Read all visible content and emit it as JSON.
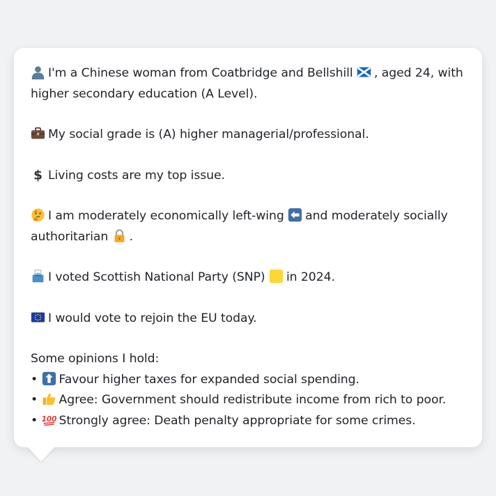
{
  "profile": {
    "identity": {
      "icon": "person-silhouette-icon",
      "text_before_flag": "I'm a Chinese woman from Coatbridge and Bellshill",
      "flag_icon": "scotland-flag-icon",
      "text_after_flag": ", aged 24, with higher secondary education (A Level)."
    },
    "social_grade": {
      "icon": "briefcase-icon",
      "text": "My social grade is (A) higher managerial/professional."
    },
    "top_issue": {
      "icon": "dollar-sign-icon",
      "text": "Living costs are my top issue."
    },
    "ideology": {
      "icon": "thinking-face-icon",
      "text_part1": "I am moderately economically left-wing",
      "left_arrow_icon": "left-arrow-icon",
      "text_part2": "and moderately socially authoritarian",
      "lock_icon": "lock-icon",
      "text_part3": "."
    },
    "vote_2024": {
      "icon": "ballot-box-icon",
      "text_before": "I voted Scottish National Party (SNP)",
      "party_color_icon": "yellow-square-icon",
      "text_after": "in 2024."
    },
    "eu": {
      "icon": "eu-flag-icon",
      "text": "I would vote to rejoin the EU today."
    },
    "opinions": {
      "heading": "Some opinions I hold:",
      "bullet": "•",
      "items": [
        {
          "icon": "up-arrow-icon",
          "text": "Favour higher taxes for expanded social spending."
        },
        {
          "icon": "thumbs-up-icon",
          "text": "Agree: Government should redistribute income from rich to poor."
        },
        {
          "icon": "hundred-points-icon",
          "text": "Strongly agree: Death penalty appropriate for some crimes."
        }
      ]
    }
  },
  "colors": {
    "page_background": "#f1f2f4",
    "card_background": "#ffffff",
    "text": "#1f2328",
    "snp_yellow": "#fdd835"
  }
}
